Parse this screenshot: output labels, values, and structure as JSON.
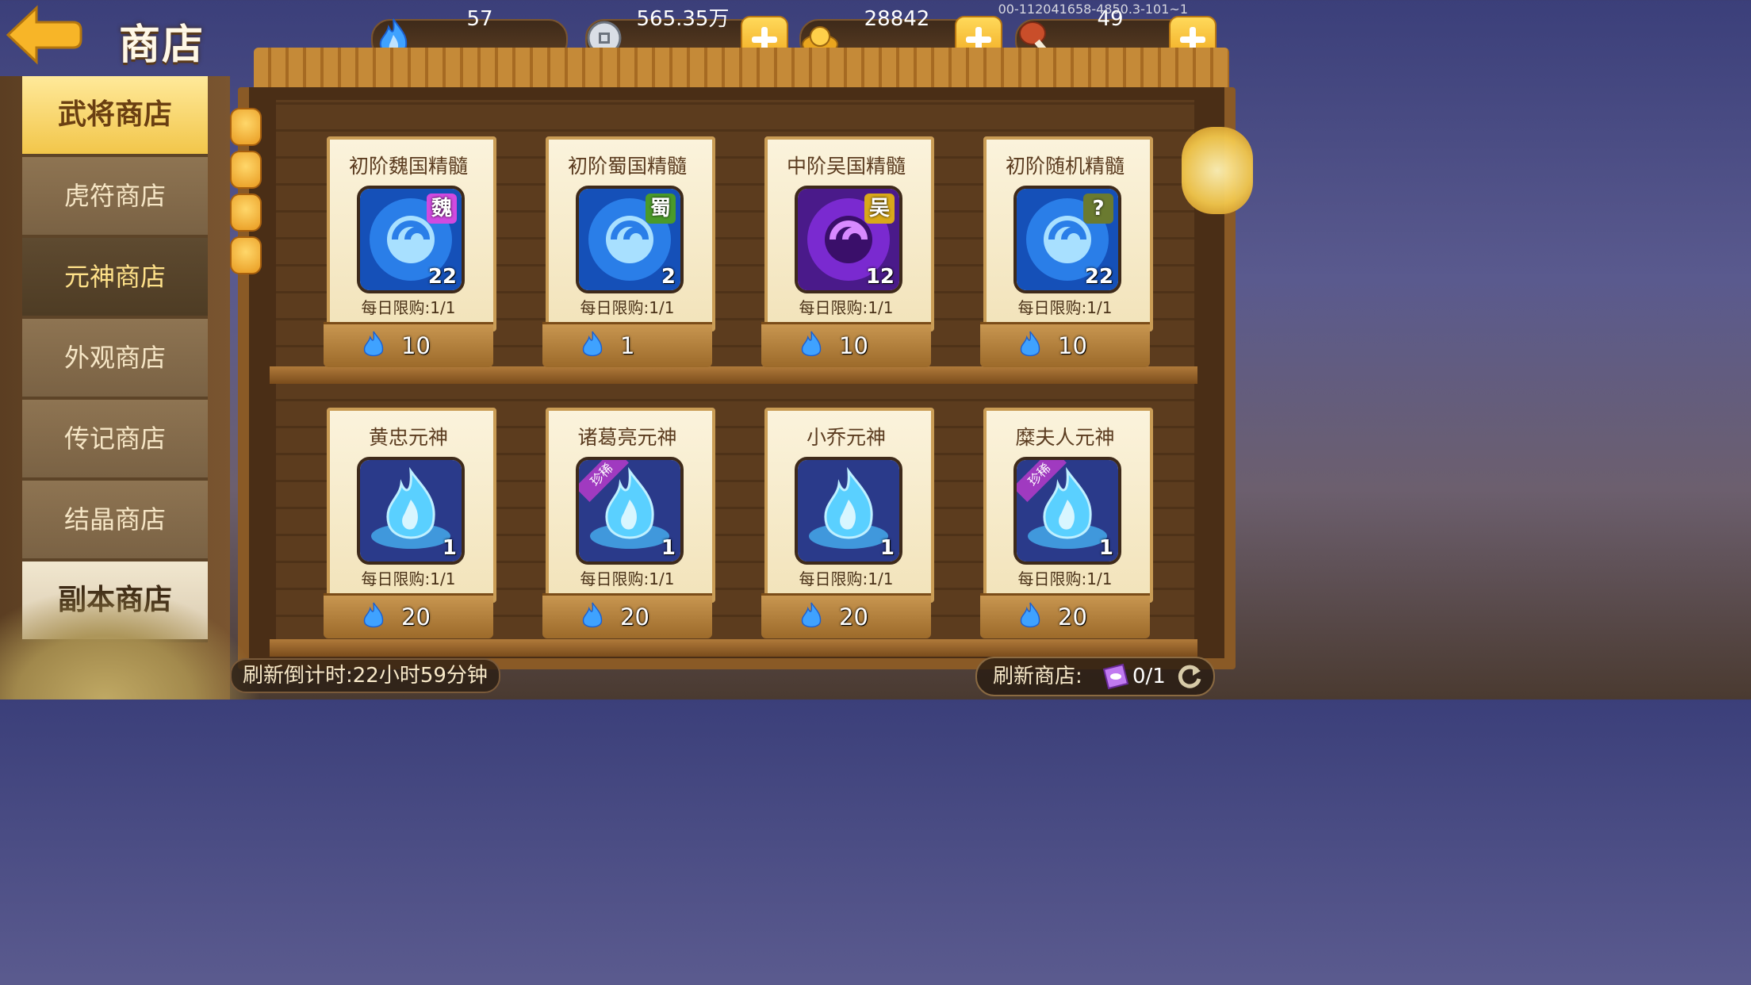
{
  "header": {
    "title": "商店",
    "build_id": "00-112041658-4850.3-101~1",
    "resources": [
      {
        "icon": "blue-flame-icon",
        "value": "57"
      },
      {
        "icon": "silver-coin-icon",
        "value": "565.35万"
      },
      {
        "icon": "gold-ingot-icon",
        "value": "28842"
      },
      {
        "icon": "meat-drumstick-icon",
        "value": "49"
      }
    ]
  },
  "sidebar": {
    "tabs": [
      {
        "label": "武将商店"
      },
      {
        "label": "虎符商店"
      },
      {
        "label": "元神商店"
      },
      {
        "label": "外观商店"
      },
      {
        "label": "传记商店"
      },
      {
        "label": "结晶商店"
      },
      {
        "label": "副本商店"
      }
    ]
  },
  "items": [
    {
      "name": "初阶魏国精髓",
      "faction": "魏",
      "count": "22",
      "limit": "每日限购:1/1",
      "price": "10"
    },
    {
      "name": "初阶蜀国精髓",
      "faction": "蜀",
      "count": "2",
      "limit": "每日限购:1/1",
      "price": "1"
    },
    {
      "name": "中阶吴国精髓",
      "faction": "吴",
      "count": "12",
      "limit": "每日限购:1/1",
      "price": "10"
    },
    {
      "name": "初阶随机精髓",
      "faction": "?",
      "count": "22",
      "limit": "每日限购:1/1",
      "price": "10"
    },
    {
      "name": "黄忠元神",
      "rare": "",
      "count": "1",
      "limit": "每日限购:1/1",
      "price": "20"
    },
    {
      "name": "诸葛亮元神",
      "rare": "珍稀",
      "count": "1",
      "limit": "每日限购:1/1",
      "price": "20"
    },
    {
      "name": "小乔元神",
      "rare": "",
      "count": "1",
      "limit": "每日限购:1/1",
      "price": "20"
    },
    {
      "name": "糜夫人元神",
      "rare": "珍稀",
      "count": "1",
      "limit": "每日限购:1/1",
      "price": "20"
    }
  ],
  "footer": {
    "timer": "刷新倒计时:22小时59分钟",
    "refresh_label": "刷新商店:",
    "refresh_count": "0/1"
  },
  "colors": {
    "accent_gold": "#f2c64a",
    "flame_blue": "#3fa2ff",
    "wei_purple": "#d04ae0",
    "shu_green": "#9adf4a",
    "wu_yellow": "#ffd83a"
  }
}
